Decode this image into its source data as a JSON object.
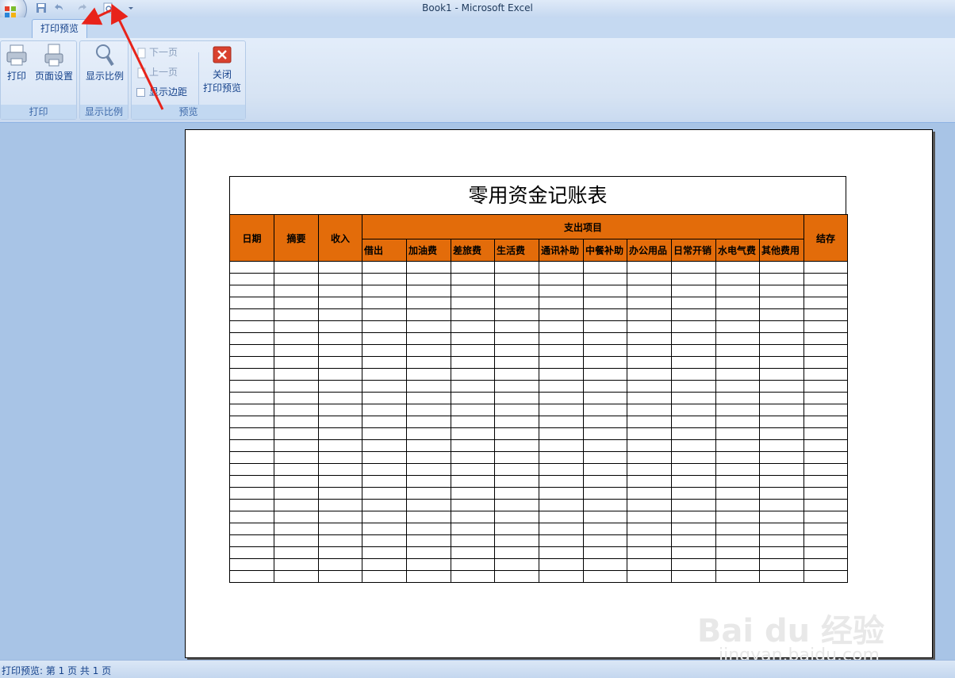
{
  "window": {
    "title": "Book1 - Microsoft Excel"
  },
  "ribbon": {
    "active_tab": "打印预览",
    "groups": {
      "print": {
        "label": "打印",
        "print_label": "打印",
        "page_setup_label": "页面设置"
      },
      "zoom": {
        "label": "显示比例",
        "zoom_label": "显示比例"
      },
      "preview": {
        "label": "预览",
        "next_page_label": "下一页",
        "prev_page_label": "上一页",
        "show_margins_label": "显示边距",
        "close_label_line1": "关闭",
        "close_label_line2": "打印预览"
      }
    }
  },
  "sheet": {
    "title": "零用资金记账表",
    "headers": {
      "date": "日期",
      "summary": "摘要",
      "income": "收入",
      "expense_group": "支出项目",
      "balance": "结存"
    },
    "expense_columns": [
      "借出",
      "加油费",
      "差旅费",
      "生活费",
      "通讯补助",
      "中餐补助",
      "办公用品",
      "日常开销",
      "水电气费",
      "其他费用"
    ],
    "empty_rows": 27,
    "header_fill": "#e36c0a"
  },
  "watermark": {
    "brand": "Bai du 经验",
    "url": "jingyan.baidu.com"
  },
  "status_bar": {
    "text": "打印预览: 第 1 页  共 1 页"
  },
  "annotation_color": "#e8231a"
}
